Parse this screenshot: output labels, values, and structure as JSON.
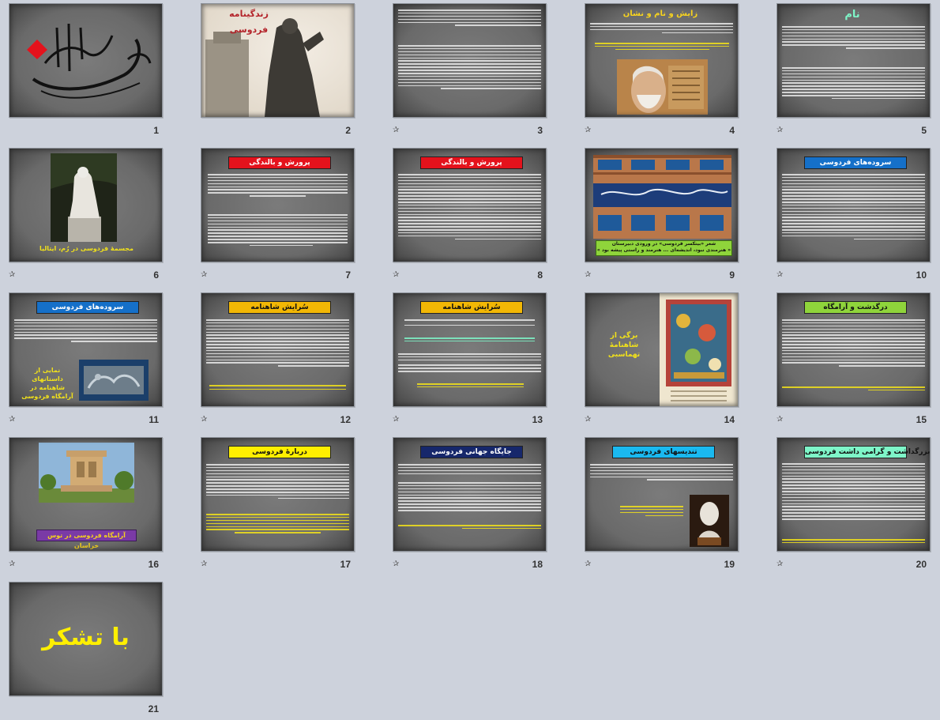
{
  "slides": [
    {
      "number": "1",
      "title": "بسم الله الرحمن الرحیم"
    },
    {
      "number": "2",
      "title": "زندگینامه",
      "subtitle": "فردوسی"
    },
    {
      "number": "3"
    },
    {
      "number": "4",
      "banner": "زایش و نام و نشان"
    },
    {
      "number": "5",
      "banner": "نام"
    },
    {
      "number": "6",
      "caption": "مجسمهٔ فردوسی در رُم، ایتالیا"
    },
    {
      "number": "7",
      "banner": "پرورش و بالندگی"
    },
    {
      "number": "8",
      "banner": "پرورش و بالندگی"
    },
    {
      "number": "9",
      "caption_line1": "شعر «بیتکسر فردوسی» در ورودی دبیرستان",
      "caption_line2": "« هنرمندی نبود، اندیشه‌ای ... هنرمند و راستی پیشه بود »"
    },
    {
      "number": "10",
      "banner": "سروده‌های فردوسی"
    },
    {
      "number": "11",
      "banner": "سروده‌های فردوسی",
      "caption": "نمایی از داستانهای شاهنامه در آرامگاه فردوسی"
    },
    {
      "number": "12",
      "banner": "سُرایش شاهنامه"
    },
    {
      "number": "13",
      "banner": "سُرایش شاهنامه"
    },
    {
      "number": "14",
      "caption": "برگی از شاهنامهٔ تهماسبی"
    },
    {
      "number": "15",
      "banner": "درگذشت و آرامگاه"
    },
    {
      "number": "16",
      "caption": "آرامگاه فردوسی در توس خراسان"
    },
    {
      "number": "17",
      "banner": "دربارهٔ فردوسی"
    },
    {
      "number": "18",
      "banner": "جایگاه جهانی فردوسی"
    },
    {
      "number": "19",
      "banner": "تندیسهای فردوسی"
    },
    {
      "number": "20",
      "banner": "بزرگداشت و گرامی داشت فردوسی"
    },
    {
      "number": "21",
      "title": "با تشکر"
    }
  ],
  "colors": {
    "red": "#e4121c",
    "yellow": "#f7d31e",
    "orange": "#f2b705",
    "blue": "#1570c9",
    "green": "#8fd43b",
    "navy": "#16276b",
    "cyan": "#1ab9f0",
    "mint": "#7ef5c8",
    "purple": "#7a3aa6",
    "lime": "#a4d94a",
    "text_yellow": "#f2e21a",
    "title_yellow": "#ffef00"
  }
}
